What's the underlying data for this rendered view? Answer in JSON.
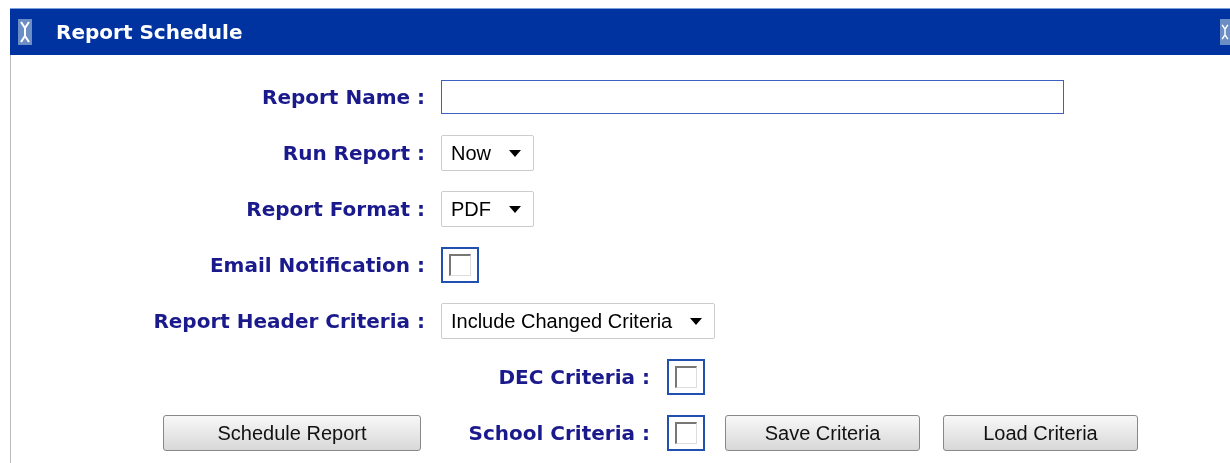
{
  "window": {
    "title": "Report Schedule"
  },
  "fields": [
    {
      "kind": "text",
      "label": "Report Name :",
      "focused": true
    },
    {
      "kind": "select",
      "label": "Run Report :",
      "value": "Now"
    },
    {
      "kind": "select",
      "label": "Report Format :",
      "value": "PDF"
    },
    {
      "kind": "checkbox",
      "label": "Email Notification :",
      "checked": false
    },
    {
      "kind": "select",
      "label": "Report Header Criteria :",
      "value": "Include Changed Criteria"
    }
  ],
  "criteria": [
    {
      "label": "DEC Criteria :",
      "checked": false
    },
    {
      "label": "School Criteria :",
      "checked": false
    }
  ],
  "buttons": {
    "schedule": "Schedule Report",
    "save": "Save Criteria",
    "load": "Load Criteria"
  }
}
